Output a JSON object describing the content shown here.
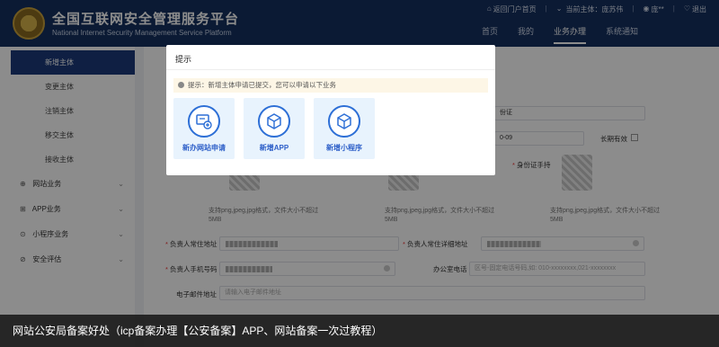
{
  "header": {
    "title_cn": "全国互联网安全管理服务平台",
    "title_en": "National Internet Security Management Service Platform",
    "top_links": {
      "portal": "返回门户首页",
      "current_subject": "当前主体：庞苏伟",
      "user": "庞**",
      "logout": "退出"
    },
    "nav": [
      "首页",
      "我的",
      "业务办理",
      "系统通知"
    ]
  },
  "sidebar": {
    "items": [
      "新增主体",
      "变更主体",
      "注销主体",
      "移交主体",
      "接收主体"
    ],
    "groups": [
      "网站业务",
      "APP业务",
      "小程序业务",
      "安全评估"
    ]
  },
  "form": {
    "id_type_tail": "份证",
    "date_tail": "0-09",
    "long_term": "长期有效",
    "id_hold_label": "身份证手持",
    "upload_hint": "支持png,jpeg,jpg格式，文件大小不超过5MB",
    "residence_label": "负责人常住地址",
    "residence_detail_label": "负责人常住详细地址",
    "phone_label": "负责人手机号码",
    "office_phone_label": "办公室电话",
    "office_phone_placeholder": "区号-固定电话号码,如: 010-xxxxxxxx,021-xxxxxxxx",
    "email_label": "电子邮件地址",
    "email_placeholder": "请输入电子邮件地址"
  },
  "modal": {
    "title": "提示",
    "notice": "提示：新增主体申请已提交，您可以申请以下业务",
    "tiles": [
      "新办网站申请",
      "新增APP",
      "新增小程序"
    ]
  },
  "caption": "网站公安局备案好处（icp备案办理【公安备案】APP、网站备案一次过教程）",
  "colors": {
    "header": "#14305f",
    "accent": "#2d6fd6",
    "tile_bg": "#e8f3fd"
  }
}
